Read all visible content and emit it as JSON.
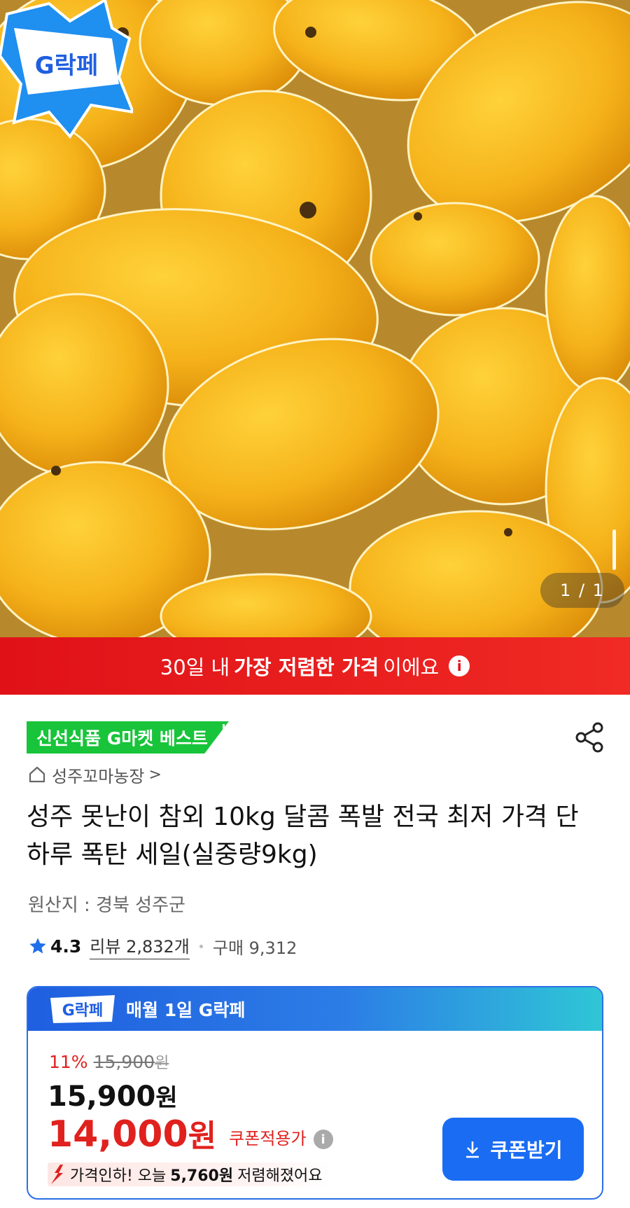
{
  "hero": {
    "page_counter": "1 / 1",
    "badge_text": "G락페"
  },
  "banner": {
    "pre": "30일 내",
    "strong": "가장 저렴한 가격",
    "post": "이에요",
    "info_glyph": "i"
  },
  "product": {
    "best_badge": "신선식품 G마켓 베스트",
    "shop_name": "성주꼬마농장",
    "shop_chevron": ">",
    "title": "성주 못난이 참외 10kg 달콤 폭발 전국 최저 가격 단 하루 폭탄 세일(실중량9kg)",
    "origin": "원산지 : 경북 성주군",
    "rating": "4.3",
    "review_label": "리뷰 2,832개",
    "purchase_label": "구매 9,312"
  },
  "price_card": {
    "logo_text": "G락페",
    "event_label": "매월 1일 G락페",
    "discount_rate": "11%",
    "original_price": "15,900",
    "original_won": "원",
    "sale_price": "15,900",
    "sale_won": "원",
    "coupon_price": "14,000",
    "coupon_won": "원",
    "coupon_label": "쿠폰적용가",
    "info_glyph": "i",
    "drop_pre": "가격인하! 오늘",
    "drop_amount": "5,760원",
    "drop_post": "저렴해졌어요",
    "coupon_button": "쿠폰받기"
  },
  "colors": {
    "banner_red": "#e01218",
    "best_green": "#18c43a",
    "price_red": "#e0211e",
    "button_blue": "#1a6cf2",
    "card_border": "#2b6fe6"
  },
  "icons": [
    "share-icon",
    "home-icon",
    "star-icon",
    "info-icon",
    "down-arrow-icon",
    "download-icon"
  ]
}
